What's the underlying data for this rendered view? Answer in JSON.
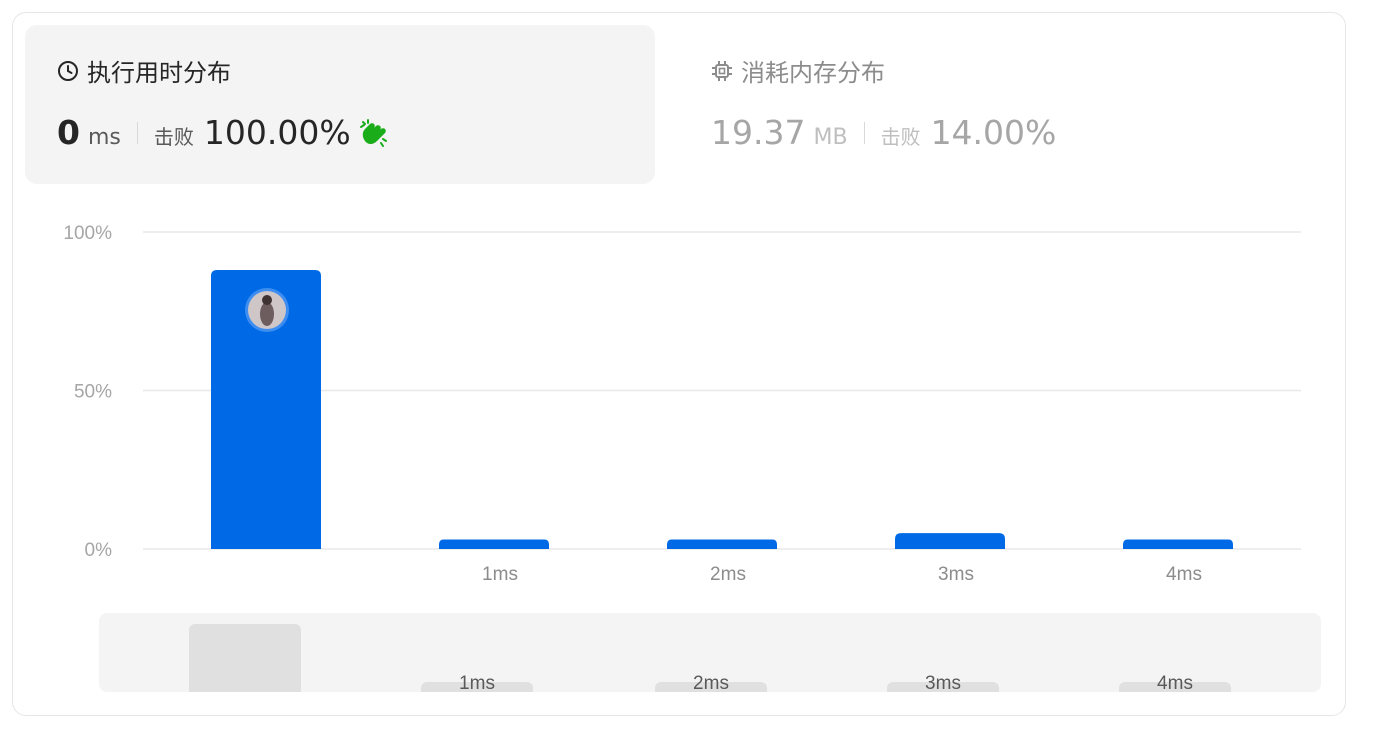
{
  "runtime": {
    "title": "执行用时分布",
    "icon": "clock-icon",
    "value": "0",
    "unit": "ms",
    "beats_label": "击败",
    "beats_pct": "100.00%",
    "badge_icon": "clap-icon"
  },
  "memory": {
    "title": "消耗内存分布",
    "icon": "chip-icon",
    "value": "19.37",
    "unit": "MB",
    "beats_label": "击败",
    "beats_pct": "14.00%"
  },
  "colors": {
    "bar": "#006ae6",
    "clap": "#1aad19"
  },
  "chart_data": {
    "type": "bar",
    "categories": [
      "",
      "1ms",
      "2ms",
      "3ms",
      "4ms"
    ],
    "values": [
      88,
      3,
      3,
      5,
      3
    ],
    "y_ticks": [
      "0%",
      "50%",
      "100%"
    ],
    "ylim": [
      0,
      100
    ],
    "grid": true,
    "user_marker_category": 0,
    "user_marker_icon": "avatar"
  },
  "overview": {
    "labels": [
      "",
      "1ms",
      "2ms",
      "3ms",
      "4ms"
    ]
  }
}
